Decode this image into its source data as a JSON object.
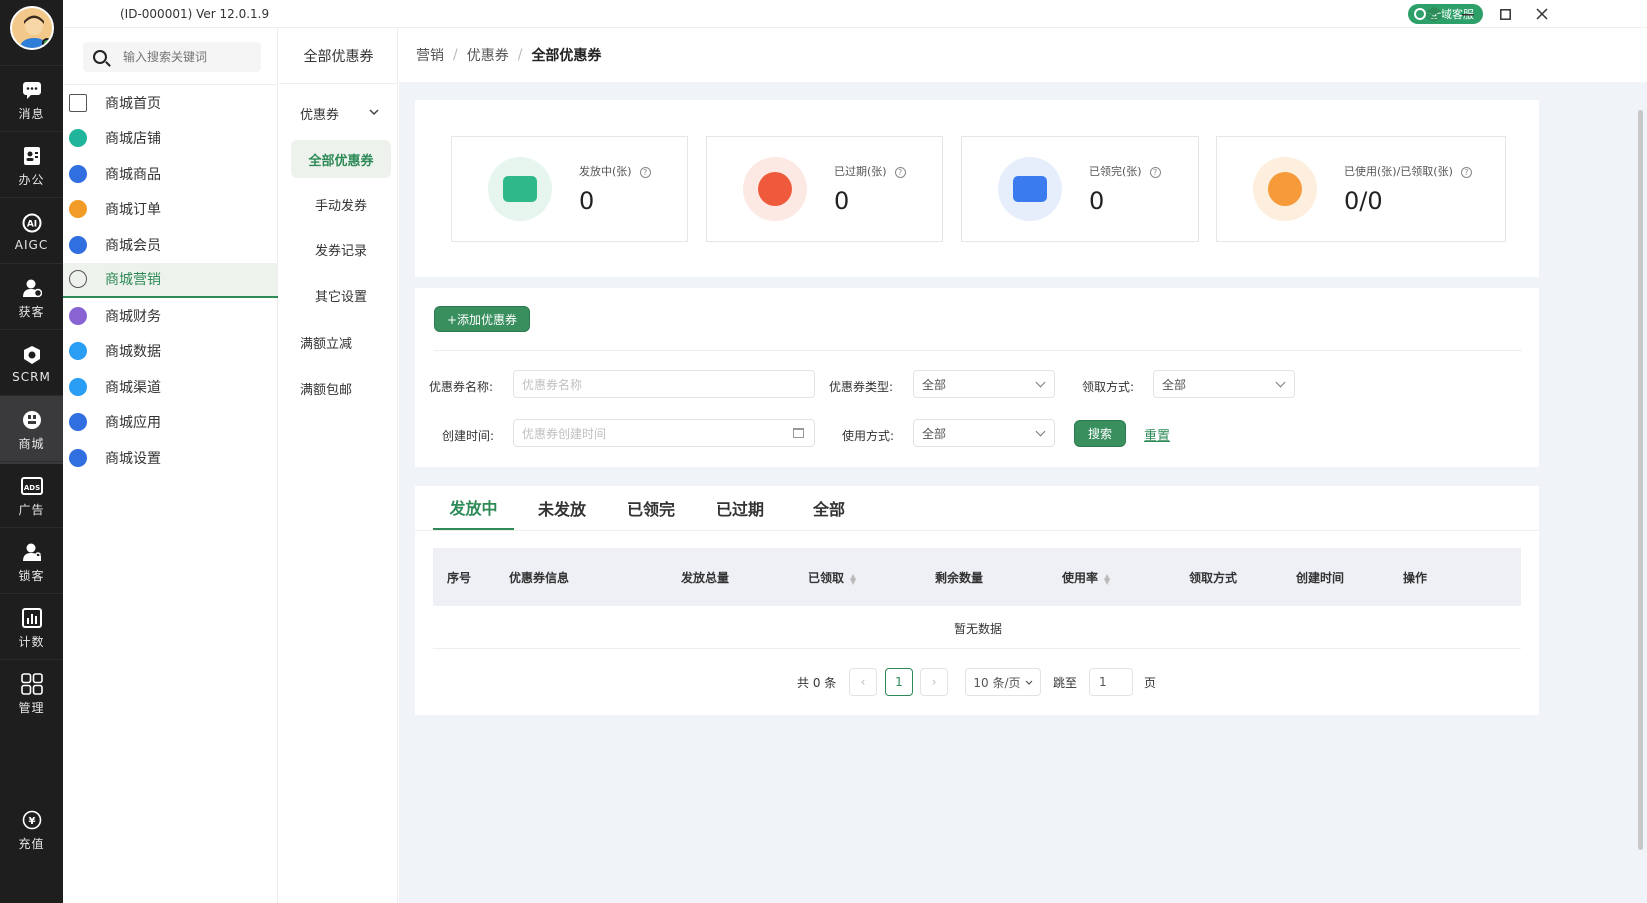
{
  "window": {
    "version_text": "(ID-000001)  Ver 12.0.1.9",
    "service_label": "全域客服"
  },
  "rail": {
    "items": [
      {
        "label": "消息",
        "icon": "chat-icon"
      },
      {
        "label": "办公",
        "icon": "contacts-icon"
      },
      {
        "label": "AIGC",
        "icon": "ai-icon"
      },
      {
        "label": "获客",
        "icon": "user-add-icon"
      },
      {
        "label": "SCRM",
        "icon": "scrm-icon"
      },
      {
        "label": "商城",
        "icon": "store-icon"
      },
      {
        "label": "广告",
        "icon": "ads-icon"
      },
      {
        "label": "锁客",
        "icon": "user-lock-icon"
      },
      {
        "label": "计数",
        "icon": "bar-chart-icon"
      },
      {
        "label": "管理",
        "icon": "grid-icon"
      }
    ],
    "bottom": {
      "label": "充值",
      "icon": "yen-icon"
    }
  },
  "nav": {
    "search_placeholder": "输入搜索关键词",
    "items": [
      {
        "label": "商城首页",
        "icon": "home-icon",
        "color": "#555555"
      },
      {
        "label": "商城店铺",
        "icon": "shop-icon",
        "color": "#1fb59a"
      },
      {
        "label": "商城商品",
        "icon": "goods-icon",
        "color": "#2f6fe0"
      },
      {
        "label": "商城订单",
        "icon": "order-icon",
        "color": "#f29b26"
      },
      {
        "label": "商城会员",
        "icon": "member-icon",
        "color": "#2f6fe0"
      },
      {
        "label": "商城营销",
        "icon": "marketing-icon",
        "color": "#555555"
      },
      {
        "label": "商城财务",
        "icon": "finance-icon",
        "color": "#8a63d2"
      },
      {
        "label": "商城数据",
        "icon": "data-icon",
        "color": "#2a9df4"
      },
      {
        "label": "商城渠道",
        "icon": "channel-icon",
        "color": "#2a9df4"
      },
      {
        "label": "商城应用",
        "icon": "app-icon",
        "color": "#2f6fe0"
      },
      {
        "label": "商城设置",
        "icon": "settings-cloud-icon",
        "color": "#2f6fe0"
      }
    ]
  },
  "subnav": {
    "title": "全部优惠券",
    "group": "优惠券",
    "children": [
      "全部优惠券",
      "手动发券",
      "发券记录",
      "其它设置"
    ],
    "others": [
      "满额立减",
      "满额包邮"
    ]
  },
  "breadcrumb": [
    "营销",
    "优惠券",
    "全部优惠券"
  ],
  "stats": [
    {
      "label": "发放中(张)",
      "value": "0",
      "color": "#2fb88a",
      "bg": "#e6f6ef",
      "icon": "coupon-send-icon"
    },
    {
      "label": "已过期(张)",
      "value": "0",
      "color": "#f05a3c",
      "bg": "#fde9e4",
      "icon": "expired-icon"
    },
    {
      "label": "已领完(张)",
      "value": "0",
      "color": "#3a7cf0",
      "bg": "#e6eefc",
      "icon": "claimed-icon"
    },
    {
      "label": "已使用(张)/已领取(张)",
      "value": "0/0",
      "color": "#f79a3a",
      "bg": "#fdeede",
      "icon": "pie-icon"
    }
  ],
  "toolbar": {
    "add_label": "+添加优惠券"
  },
  "filters": {
    "name_label": "优惠券名称:",
    "name_placeholder": "优惠券名称",
    "type_label": "优惠券类型:",
    "type_value": "全部",
    "claim_label": "领取方式:",
    "claim_value": "全部",
    "time_label": "创建时间:",
    "time_placeholder": "优惠券创建时间",
    "use_label": "使用方式:",
    "use_value": "全部",
    "search_label": "搜索",
    "reset_label": "重置"
  },
  "tabs": [
    "发放中",
    "未发放",
    "已领完",
    "已过期",
    "全部"
  ],
  "table": {
    "columns": [
      "序号",
      "优惠券信息",
      "发放总量",
      "已领取",
      "剩余数量",
      "使用率",
      "领取方式",
      "创建时间",
      "操作"
    ],
    "empty_text": "暂无数据"
  },
  "pagination": {
    "total_text": "共 0 条",
    "current_page": "1",
    "page_size": "10 条/页",
    "jump_label": "跳至",
    "jump_value": "1",
    "page_unit": "页"
  }
}
